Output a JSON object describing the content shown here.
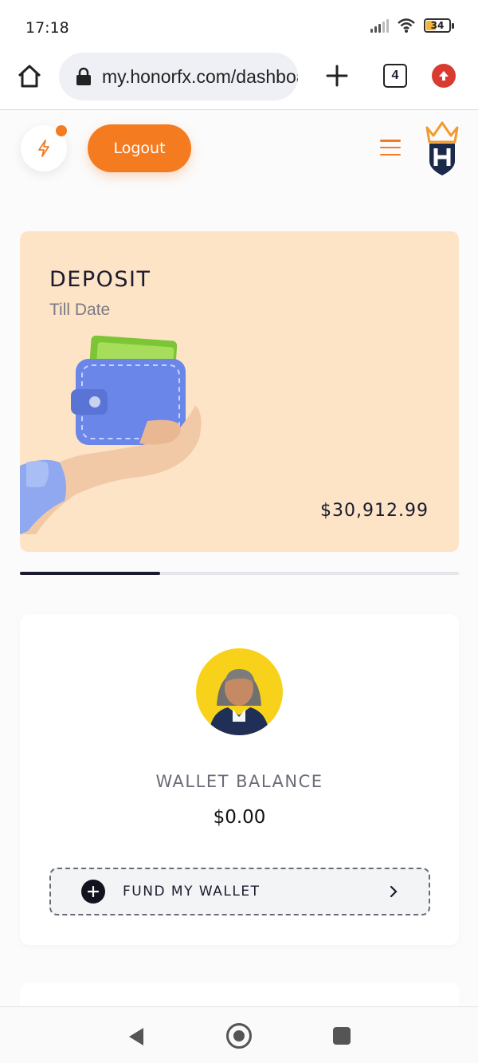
{
  "status_bar": {
    "time": "17:18",
    "battery": "34",
    "icons": [
      "signal-icon",
      "wifi-icon",
      "battery-icon"
    ]
  },
  "browser": {
    "url": "my.honorfx.com/dashboard",
    "tab_count": "4",
    "icons": [
      "home-icon",
      "lock-icon",
      "plus-icon",
      "tabs-icon",
      "update-icon"
    ]
  },
  "header": {
    "logout_label": "Logout",
    "icons": [
      "bolt-icon",
      "menu-icon",
      "crown-logo"
    ],
    "accent_color": "#f47b20"
  },
  "deposit": {
    "title": "DEPOSIT",
    "subtitle": "Till Date",
    "amount": "$30,912.99",
    "background_color": "#fde4c6",
    "icon": "wallet-in-hand-illustration"
  },
  "carousel": {
    "progress_fraction": 0.32
  },
  "wallet": {
    "label": "WALLET BALANCE",
    "balance": "$0.00",
    "fund_label": "FUND MY WALLET",
    "icons": [
      "avatar",
      "plus-circle-icon",
      "chevron-right-icon"
    ]
  },
  "nav_bar": {
    "icons": [
      "back-icon",
      "home-circle-icon",
      "recent-apps-icon"
    ]
  }
}
